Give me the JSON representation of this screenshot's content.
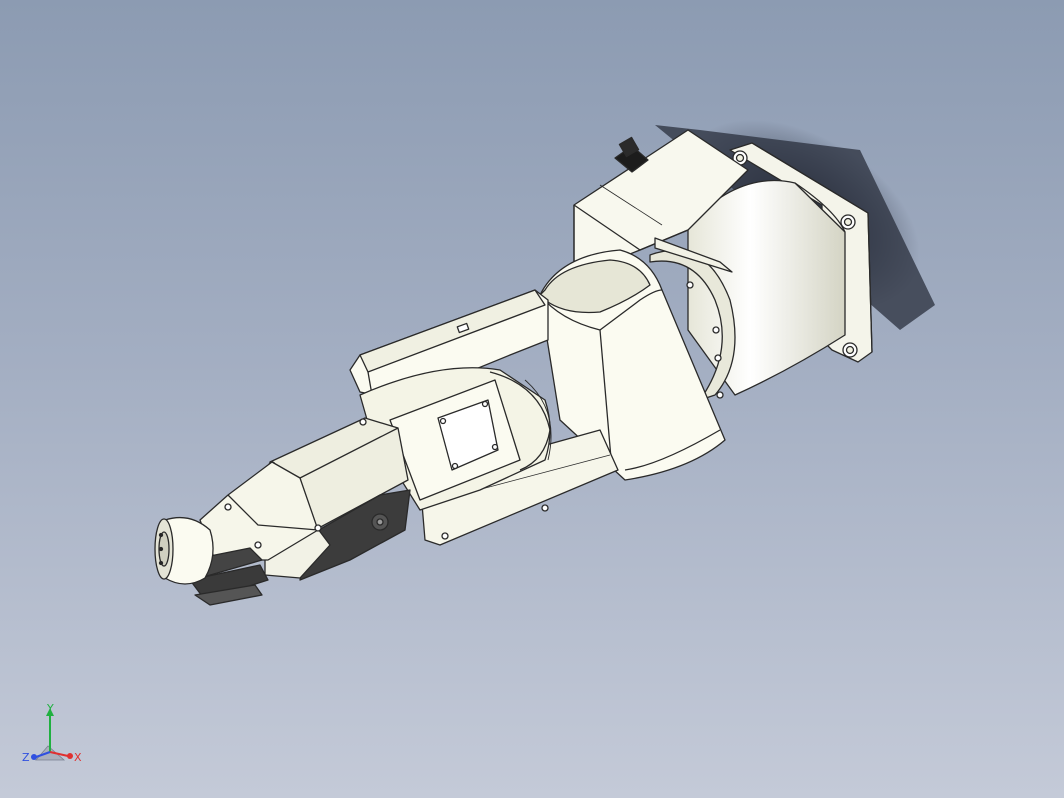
{
  "viewport": {
    "background_top": "#8c9bb2",
    "background_bottom": "#c4cad8"
  },
  "model": {
    "body_color": "#fbfbf1",
    "shade_color": "#d9d9c8",
    "edge_color": "#2a2a2a",
    "dark_part_color": "#3c3c3c"
  },
  "triad": {
    "x_label": "X",
    "y_label": "Y",
    "z_label": "Z",
    "x_color": "#e03030",
    "y_color": "#20b040",
    "z_color": "#3050e0"
  }
}
